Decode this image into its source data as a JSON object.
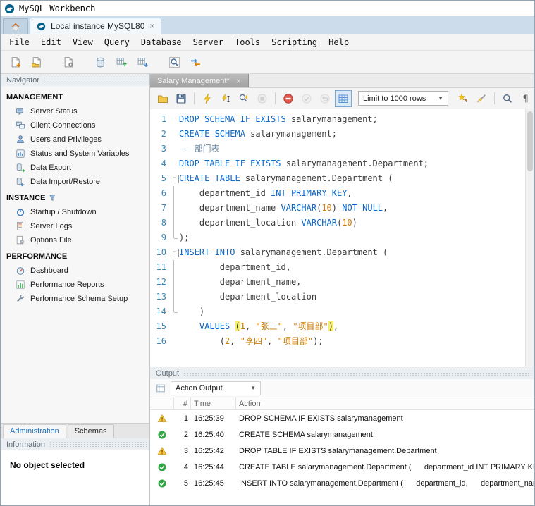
{
  "window": {
    "title": "MySQL Workbench"
  },
  "tabs": {
    "connection": {
      "label": "Local instance MySQL80"
    }
  },
  "menubar": {
    "items": [
      "File",
      "Edit",
      "View",
      "Query",
      "Database",
      "Server",
      "Tools",
      "Scripting",
      "Help"
    ]
  },
  "main_toolbar": {
    "buttons": [
      {
        "name": "new-query-tab",
        "icon": "doc-plus"
      },
      {
        "name": "open-sql-script",
        "icon": "doc-folder"
      },
      {
        "gap": true
      },
      {
        "name": "open-inspector",
        "icon": "doc-gear"
      },
      {
        "gap": true
      },
      {
        "name": "create-schema",
        "icon": "db"
      },
      {
        "name": "table-data-export",
        "icon": "table-up"
      },
      {
        "name": "table-data-import",
        "icon": "table-down"
      },
      {
        "gap": true
      },
      {
        "name": "search-table-data",
        "icon": "mag-frame"
      },
      {
        "name": "migration-wizard",
        "icon": "migration"
      }
    ]
  },
  "navigator": {
    "header": "Navigator",
    "sections": [
      {
        "title": "MANAGEMENT",
        "items": [
          {
            "label": "Server Status",
            "icon": "server-status"
          },
          {
            "label": "Client Connections",
            "icon": "client-connections"
          },
          {
            "label": "Users and Privileges",
            "icon": "users"
          },
          {
            "label": "Status and System Variables",
            "icon": "sys-vars"
          },
          {
            "label": "Data Export",
            "icon": "data-export"
          },
          {
            "label": "Data Import/Restore",
            "icon": "data-import"
          }
        ]
      },
      {
        "title": "INSTANCE",
        "title_icon": "filter",
        "items": [
          {
            "label": "Startup / Shutdown",
            "icon": "startup"
          },
          {
            "label": "Server Logs",
            "icon": "server-logs"
          },
          {
            "label": "Options File",
            "icon": "options-file"
          }
        ]
      },
      {
        "title": "PERFORMANCE",
        "items": [
          {
            "label": "Dashboard",
            "icon": "dashboard"
          },
          {
            "label": "Performance Reports",
            "icon": "perf-reports"
          },
          {
            "label": "Performance Schema Setup",
            "icon": "perf-schema"
          }
        ]
      }
    ]
  },
  "sidebar_tabs": [
    {
      "label": "Administration",
      "active": true
    },
    {
      "label": "Schemas",
      "active": false
    }
  ],
  "information": {
    "header": "Information",
    "message": "No object selected"
  },
  "editor": {
    "tab": {
      "label": "Salary Management*"
    },
    "toolbar": {
      "items": [
        {
          "t": "btn",
          "name": "open-script",
          "icon": "folder"
        },
        {
          "t": "btn",
          "name": "save-script",
          "icon": "save"
        },
        {
          "t": "sep"
        },
        {
          "t": "btn",
          "name": "execute-script",
          "icon": "bolt"
        },
        {
          "t": "btn",
          "name": "execute-current-statement",
          "icon": "bolt-cursor"
        },
        {
          "t": "btn",
          "name": "explain-plan",
          "icon": "bolt-mag"
        },
        {
          "t": "btn",
          "name": "stop-execution",
          "icon": "stop-gray",
          "disabled": true
        },
        {
          "t": "sep"
        },
        {
          "t": "btn",
          "name": "toggle-stop-on-error",
          "icon": "stop-red"
        },
        {
          "t": "btn",
          "name": "commit-transaction",
          "icon": "commit",
          "disabled": true
        },
        {
          "t": "btn",
          "name": "rollback-transaction",
          "icon": "rollback",
          "disabled": true
        },
        {
          "t": "btn",
          "name": "toggle-limit-rows",
          "icon": "grid-blue",
          "active": true
        },
        {
          "t": "dropdown",
          "name": "limit-rows-dropdown",
          "value": "Limit to 1000 rows"
        },
        {
          "t": "btn",
          "name": "save-snippet",
          "icon": "wand"
        },
        {
          "t": "btn",
          "name": "beautify-script",
          "icon": "broom"
        },
        {
          "t": "sep"
        },
        {
          "t": "btn",
          "name": "find-panel",
          "icon": "mag"
        },
        {
          "t": "btn",
          "name": "toggle-invisible-characters",
          "icon": "pilcrow"
        }
      ]
    },
    "code": {
      "lines": [
        {
          "n": 1,
          "fold": "",
          "segs": [
            [
              "k",
              "DROP SCHEMA IF EXISTS"
            ],
            [
              "p",
              " salarymanagement;"
            ]
          ]
        },
        {
          "n": 2,
          "fold": "",
          "segs": [
            [
              "k",
              "CREATE SCHEMA"
            ],
            [
              "p",
              " salarymanagement;"
            ]
          ]
        },
        {
          "n": 3,
          "fold": "",
          "segs": [
            [
              "c",
              "-- 部门表"
            ]
          ]
        },
        {
          "n": 4,
          "fold": "",
          "segs": [
            [
              "k",
              "DROP TABLE IF EXISTS"
            ],
            [
              "p",
              " salarymanagement.Department;"
            ]
          ]
        },
        {
          "n": 5,
          "fold": "start",
          "segs": [
            [
              "k",
              "CREATE TABLE"
            ],
            [
              "p",
              " salarymanagement.Department ("
            ]
          ]
        },
        {
          "n": 6,
          "fold": "mid",
          "segs": [
            [
              "p",
              "    department_id "
            ],
            [
              "k",
              "INT PRIMARY KEY"
            ],
            [
              "p",
              ","
            ]
          ]
        },
        {
          "n": 7,
          "fold": "mid",
          "segs": [
            [
              "p",
              "    department_name "
            ],
            [
              "k",
              "VARCHAR"
            ],
            [
              "p",
              "("
            ],
            [
              "m",
              "10"
            ],
            [
              "p",
              ") "
            ],
            [
              "k",
              "NOT NULL"
            ],
            [
              "p",
              ","
            ]
          ]
        },
        {
          "n": 8,
          "fold": "mid",
          "segs": [
            [
              "p",
              "    department_location "
            ],
            [
              "k",
              "VARCHAR"
            ],
            [
              "p",
              "("
            ],
            [
              "m",
              "10"
            ],
            [
              "p",
              ")"
            ]
          ]
        },
        {
          "n": 9,
          "fold": "end",
          "segs": [
            [
              "p",
              ");"
            ]
          ]
        },
        {
          "n": 10,
          "fold": "start",
          "segs": [
            [
              "k",
              "INSERT INTO"
            ],
            [
              "p",
              " salarymanagement.Department ("
            ]
          ]
        },
        {
          "n": 11,
          "fold": "mid",
          "segs": [
            [
              "p",
              "        department_id,"
            ]
          ]
        },
        {
          "n": 12,
          "fold": "mid",
          "segs": [
            [
              "p",
              "        department_name,"
            ]
          ]
        },
        {
          "n": 13,
          "fold": "mid",
          "segs": [
            [
              "p",
              "        department_location"
            ]
          ]
        },
        {
          "n": 14,
          "fold": "end",
          "segs": [
            [
              "p",
              "    )"
            ]
          ]
        },
        {
          "n": 15,
          "fold": "",
          "segs": [
            [
              "p",
              "    "
            ],
            [
              "k",
              "VALUES"
            ],
            [
              "p",
              " "
            ],
            [
              "h",
              "("
            ],
            [
              "m",
              "1"
            ],
            [
              "p",
              ", "
            ],
            [
              "s",
              "\"张三\""
            ],
            [
              "p",
              ", "
            ],
            [
              "s",
              "\"项目部\""
            ],
            [
              "h",
              ")"
            ],
            [
              "p",
              ","
            ]
          ]
        },
        {
          "n": 16,
          "fold": "",
          "segs": [
            [
              "p",
              "        ("
            ],
            [
              "m",
              "2"
            ],
            [
              "p",
              ", "
            ],
            [
              "s",
              "\"李四\""
            ],
            [
              "p",
              ", "
            ],
            [
              "s",
              "\"项目部\""
            ],
            [
              "p",
              ");"
            ]
          ]
        }
      ]
    }
  },
  "output": {
    "header": "Output",
    "view_selector": "Action Output",
    "columns": [
      "#",
      "Time",
      "Action"
    ],
    "rows": [
      {
        "status": "warning",
        "index": "1",
        "time": "16:25:39",
        "action": "DROP SCHEMA IF EXISTS salarymanagement"
      },
      {
        "status": "success",
        "index": "2",
        "time": "16:25:40",
        "action": "CREATE SCHEMA salarymanagement"
      },
      {
        "status": "warning",
        "index": "3",
        "time": "16:25:42",
        "action": "DROP TABLE IF EXISTS salarymanagement.Department"
      },
      {
        "status": "success",
        "index": "4",
        "time": "16:25:44",
        "action": "CREATE TABLE salarymanagement.Department (      department_id INT PRIMARY KEY,"
      },
      {
        "status": "success",
        "index": "5",
        "time": "16:25:45",
        "action": "INSERT INTO salarymanagement.Department (      department_id,      department_name,"
      }
    ]
  },
  "colors": {
    "keyword": "#0c68c9",
    "string": "#ce7b00",
    "comment": "#6e8ca6",
    "line_number": "#3a87b5",
    "brace_highlight": "#f8ef6a",
    "success": "#2fa642",
    "warning": "#f8c63c",
    "active_tab_text": "#1a70c0"
  }
}
